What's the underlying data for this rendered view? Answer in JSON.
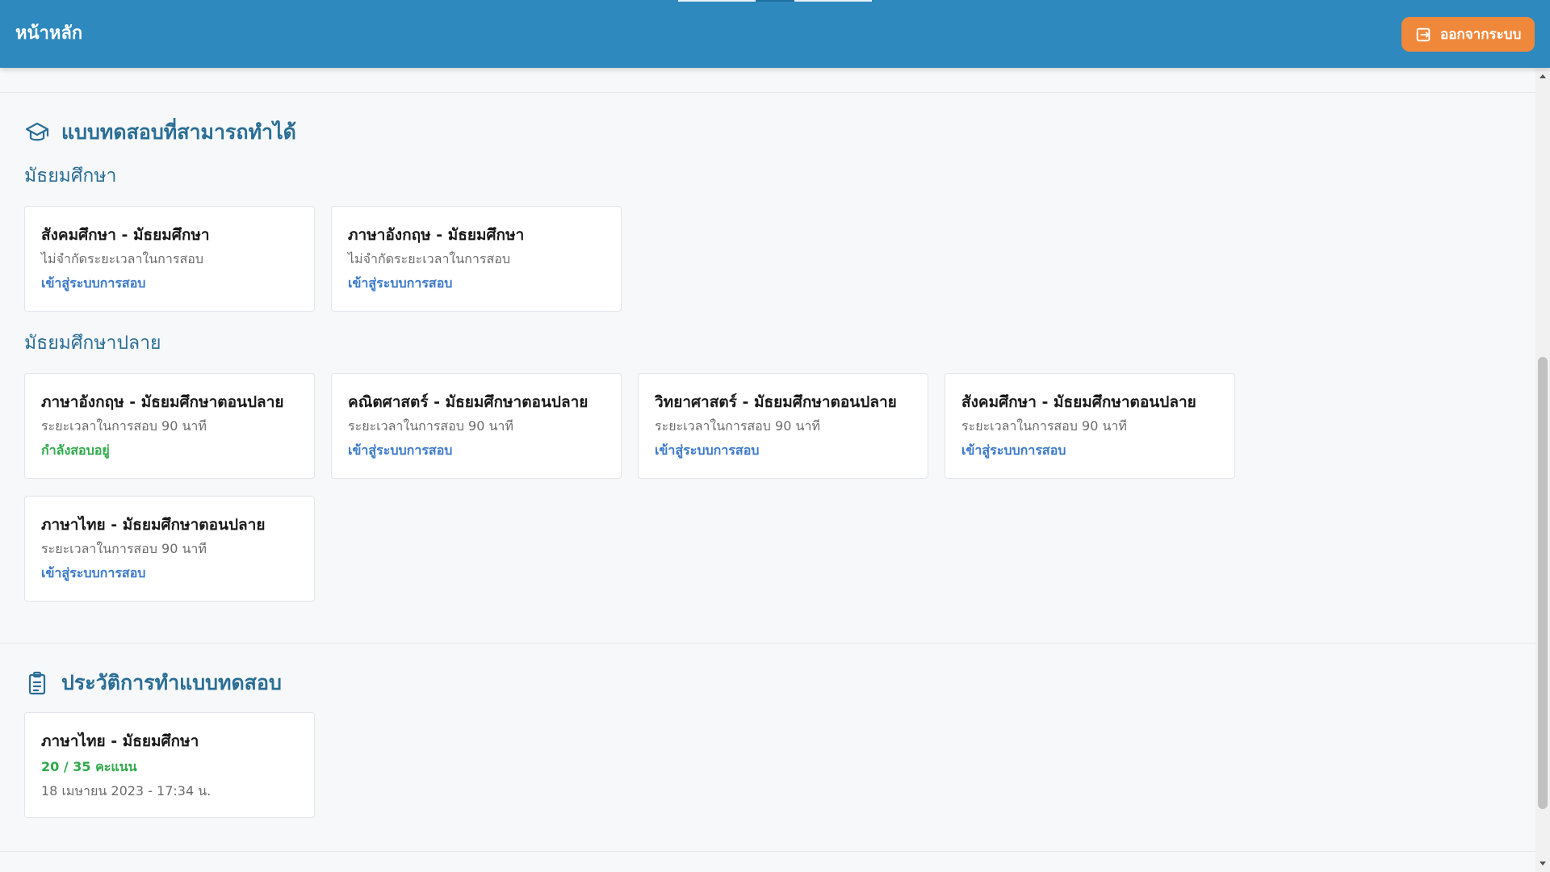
{
  "header": {
    "title": "หน้าหลัก",
    "logout_label": "ออกจากระบบ",
    "logout_icon": "logout-icon",
    "background": "#2e89be",
    "button_color": "#f0883b"
  },
  "available_exams": {
    "title": "แบบทดสอบที่สามารถทำได้",
    "icon": "graduation-cap-icon",
    "groups": [
      {
        "title": "มัธยมศึกษา",
        "cards": [
          {
            "title": "สังคมศึกษา - มัธยมศึกษา",
            "duration": "ไม่จำกัดระยะเวลาในการสอบ",
            "action": "เข้าสู่ระบบการสอบ"
          },
          {
            "title": "ภาษาอังกฤษ - มัธยมศึกษา",
            "duration": "ไม่จำกัดระยะเวลาในการสอบ",
            "action": "เข้าสู่ระบบการสอบ"
          }
        ]
      },
      {
        "title": "มัธยมศึกษาปลาย",
        "cards": [
          {
            "title": "ภาษาอังกฤษ - มัธยมศึกษาตอนปลาย",
            "duration": "ระยะเวลาในการสอบ 90 นาที",
            "action": "กำลังสอบอยู่"
          },
          {
            "title": "คณิตศาสตร์ - มัธยมศึกษาตอนปลาย",
            "duration": "ระยะเวลาในการสอบ 90 นาที",
            "action": "เข้าสู่ระบบการสอบ"
          },
          {
            "title": "วิทยาศาสตร์ - มัธยมศึกษาตอนปลาย",
            "duration": "ระยะเวลาในการสอบ 90 นาที",
            "action": "เข้าสู่ระบบการสอบ"
          },
          {
            "title": "สังคมศึกษา - มัธยมศึกษาตอนปลาย",
            "duration": "ระยะเวลาในการสอบ 90 นาที",
            "action": "เข้าสู่ระบบการสอบ"
          },
          {
            "title": "ภาษาไทย - มัธยมศึกษาตอนปลาย",
            "duration": "ระยะเวลาในการสอบ 90 นาที",
            "action": "เข้าสู่ระบบการสอบ"
          }
        ]
      }
    ]
  },
  "history": {
    "title": "ประวัติการทำแบบทดสอบ",
    "icon": "clipboard-list-icon",
    "items": [
      {
        "title": "ภาษาไทย - มัธยมศึกษา",
        "score": "20 / 35 คะแนน",
        "date": "18 เมษายน 2023 - 17:34 น."
      }
    ]
  },
  "colors": {
    "accent": "#2a6e95",
    "link": "#3a78c9",
    "success": "#2eaa4a"
  }
}
